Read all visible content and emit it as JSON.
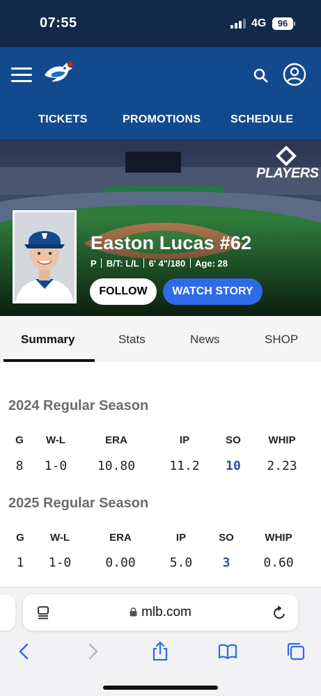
{
  "status_bar": {
    "time": "07:55",
    "network": "4G",
    "battery": "96"
  },
  "header": {
    "nav": [
      "TICKETS",
      "PROMOTIONS",
      "SCHEDULE"
    ]
  },
  "hero": {
    "brand_badge": "PLAYERS",
    "player_name": "Easton Lucas #62",
    "meta": {
      "position": "P",
      "bats_throws": "B/T: L/L",
      "height_weight": "6' 4\"/180",
      "age": "Age: 28"
    },
    "follow_label": "FOLLOW",
    "watch_label": "WATCH STORY"
  },
  "tabs": [
    "Summary",
    "Stats",
    "News",
    "SHOP"
  ],
  "seasons": [
    {
      "title": "2024 Regular Season",
      "headers": [
        "G",
        "W-L",
        "ERA",
        "IP",
        "SO",
        "WHIP"
      ],
      "values": [
        "8",
        "1-0",
        "10.80",
        "11.2",
        "10",
        "2.23"
      ]
    },
    {
      "title": "2025 Regular Season",
      "headers": [
        "G",
        "W-L",
        "ERA",
        "IP",
        "SO",
        "WHIP"
      ],
      "values": [
        "1",
        "1-0",
        "0.00",
        "5.0",
        "3",
        "0.60"
      ]
    }
  ],
  "browser": {
    "url": "mlb.com"
  },
  "colors": {
    "status_bg": "#14294a",
    "header_bg": "#134a8e",
    "accent_blue": "#2e6be6",
    "link_blue": "#2a4f9e"
  },
  "icons": [
    "hamburger-icon",
    "blue-jays-logo",
    "search-icon",
    "account-icon",
    "reader-icon",
    "lock-icon",
    "reload-icon",
    "back-icon",
    "forward-icon",
    "share-icon",
    "bookmarks-icon",
    "tabs-icon"
  ]
}
